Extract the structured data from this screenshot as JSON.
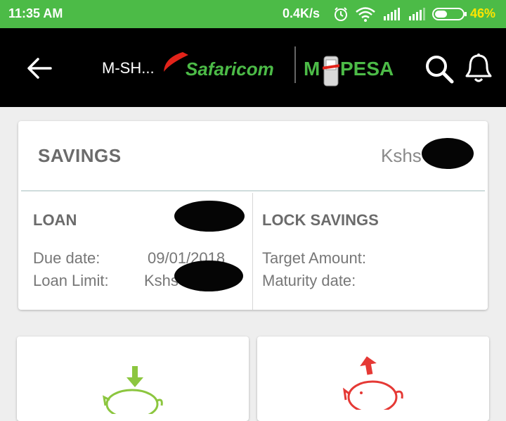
{
  "status_bar": {
    "time": "11:35 AM",
    "network_speed": "0.4K/s",
    "battery_percent": "46%",
    "battery_level": 0.46,
    "icons": [
      "alarm-icon",
      "wifi-icon",
      "signal-icon",
      "signal-icon",
      "battery-icon"
    ]
  },
  "app_bar": {
    "title": "M-SH...",
    "brand_safaricom": "Safaricom",
    "brand_mpesa_m": "M",
    "brand_mpesa_rest": "PESA",
    "icons": [
      "back-arrow-icon",
      "search-icon",
      "bell-icon"
    ]
  },
  "savings": {
    "label": "SAVINGS",
    "amount_prefix": "Kshs"
  },
  "loan": {
    "label": "LOAN",
    "due_date_label": "Due date:",
    "due_date_value": "09/01/2018",
    "limit_label": "Loan Limit:",
    "limit_prefix": "Kshs"
  },
  "lock_savings": {
    "label": "LOCK SAVINGS",
    "target_label": "Target Amount:",
    "maturity_label": "Maturity date:"
  },
  "tiles": [
    {
      "icon": "piggy-bank-deposit-icon",
      "color": "#8cc63f"
    },
    {
      "icon": "piggy-bank-withdraw-icon",
      "color": "#e53935"
    }
  ],
  "colors": {
    "status_bar": "#4cbb47",
    "app_bar": "#000000",
    "brand_green": "#4cbb47",
    "brand_red": "#e2231a",
    "battery_text": "#ffe500"
  }
}
